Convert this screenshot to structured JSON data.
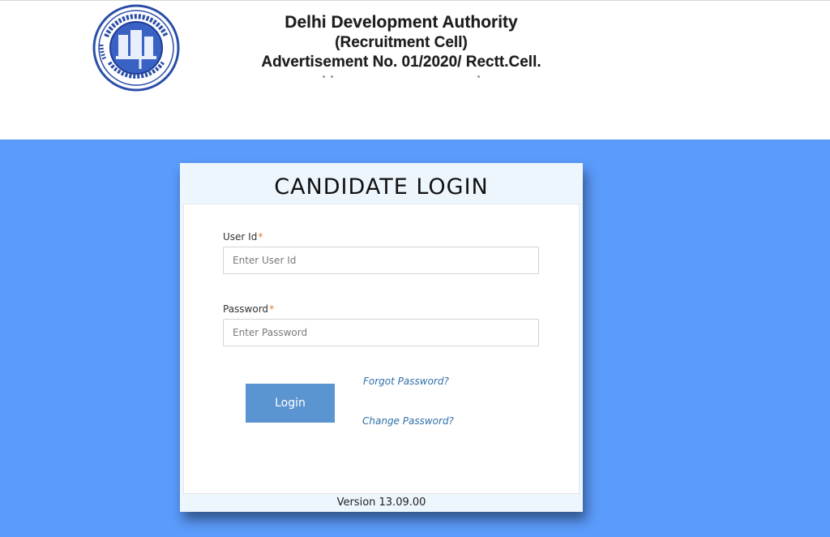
{
  "header": {
    "org_name": "Delhi Development Authority",
    "cell": "(Recruitment Cell)",
    "advertisement": "Advertisement No. 01/2020/ Rectt.Cell."
  },
  "login": {
    "title": "CANDIDATE LOGIN",
    "user_id_label": "User Id",
    "user_id_placeholder": "Enter User Id",
    "password_label": "Password",
    "password_placeholder": "Enter Password",
    "required_marker": "*",
    "login_button": "Login",
    "forgot_password": "Forgot Password?",
    "change_password": "Change Password?",
    "version": "Version 13.09.00"
  },
  "colors": {
    "band": "#5b9bfb",
    "button": "#5b95d1",
    "link": "#2f6fa8",
    "required": "#e07a2a"
  },
  "icons": {
    "logo": "dda-emblem"
  }
}
